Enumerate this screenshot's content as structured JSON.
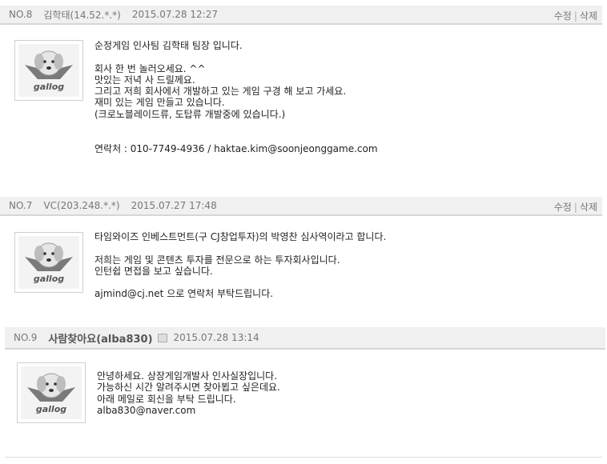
{
  "actions": {
    "edit": "수정",
    "sep": "|",
    "delete": "삭제"
  },
  "avatar_text": "gallog",
  "comments": [
    {
      "no": "NO.8",
      "author": "김학태(14.52.*.*)",
      "date": "2015.07.28 12:27",
      "lines": [
        "순정게임 인사팀 김학태 팀장 입니다.",
        "",
        "회사 한 번 놀러오세요. ^^",
        "맛있는 저녁 사 드릴께요.",
        "그리고 저희 회사에서 개발하고 있는 게임 구경 해 보고 가세요.",
        "재미 있는 게임 만들고 있습니다.",
        "(크로노블레이드류, 도탑류 개발중에 있습니다.)",
        "",
        "",
        "연락처 : 010-7749-4936 / haktae.kim@soonjeonggame.com"
      ]
    },
    {
      "no": "NO.7",
      "author": "VC(203.248.*.*)",
      "date": "2015.07.27 17:48",
      "lines": [
        "타임와이즈 인베스트먼트(구 CJ창업투자)의 박영찬 심사역이라고 합니다.",
        "",
        "저희는 게임 및 콘텐츠 투자를 전문으로 하는 투자회사입니다.",
        "인턴쉽 면접을 보고 싶습니다.",
        "",
        "ajmind@cj.net 으로 연락처 부탁드립니다."
      ]
    },
    {
      "no": "NO.9",
      "author": "사람찾아요(alba830)",
      "date": "2015.07.28 13:14",
      "lines": [
        "안녕하세요. 상장게임개발사 인사실장입니다.",
        "가능하신 시간 알려주시면 찾아뵙고 싶은데요.",
        "아래 메일로 회신을 부탁 드립니다.",
        "alba830@naver.com"
      ]
    }
  ]
}
